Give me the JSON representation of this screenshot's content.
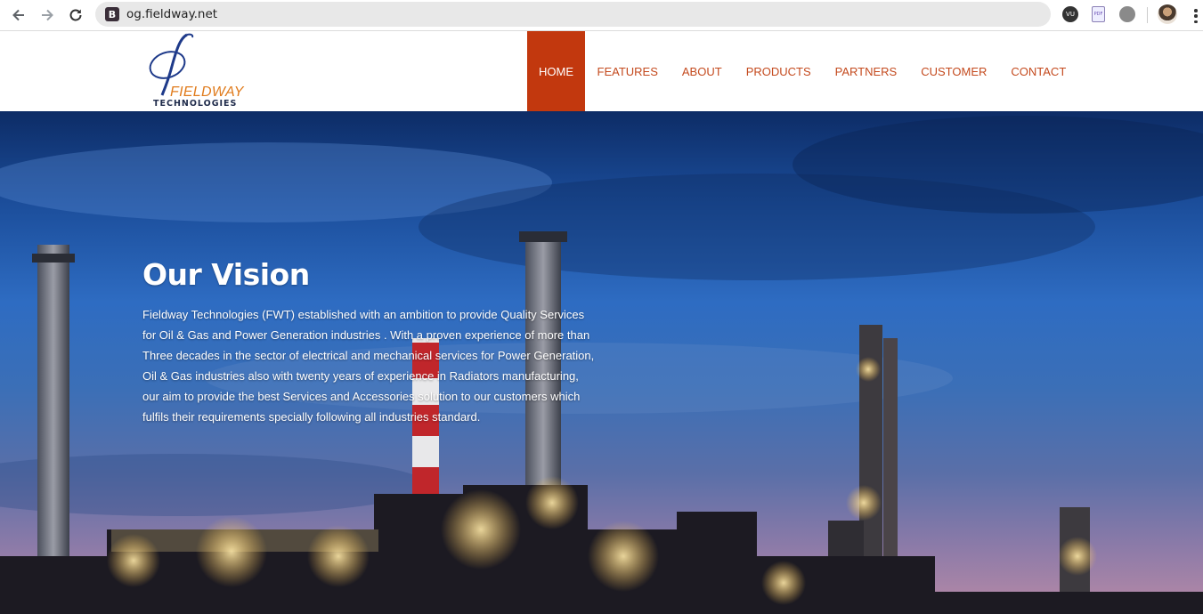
{
  "browser": {
    "url": "og.fieldway.net",
    "favicon_letter": "B",
    "extensions": [
      {
        "name": "vu-extension-icon",
        "label": "VU"
      },
      {
        "name": "pdf-extension-icon",
        "label": "PDF"
      },
      {
        "name": "gray-extension-icon",
        "label": ""
      }
    ]
  },
  "header": {
    "logo": {
      "word": "FIELDWAY",
      "sub": "TECHNOLOGIES",
      "colors": {
        "primary": "#1e3a8a",
        "accent": "#e07b1c"
      }
    },
    "nav": [
      {
        "label": "HOME",
        "active": true
      },
      {
        "label": "FEATURES",
        "active": false
      },
      {
        "label": "ABOUT",
        "active": false
      },
      {
        "label": "PRODUCTS",
        "active": false
      },
      {
        "label": "PARTNERS",
        "active": false
      },
      {
        "label": "CUSTOMER",
        "active": false
      },
      {
        "label": "CONTACT",
        "active": false
      }
    ],
    "colors": {
      "nav_text": "#c44a1e",
      "active_bg": "#c2380e"
    }
  },
  "hero": {
    "title": "Our Vision",
    "text": "Fieldway Technologies (FWT) established with an ambition to provide Quality Services for Oil & Gas and Power Generation industries . With a proven experience of more than Three decades in the sector of electrical and mechanical services for Power Generation, Oil & Gas industries also with twenty years of experience in Radiators manufacturing, our aim to provide the best Services and Accessories solution to our customers which fulfils their requirements specially following all industries standard."
  }
}
